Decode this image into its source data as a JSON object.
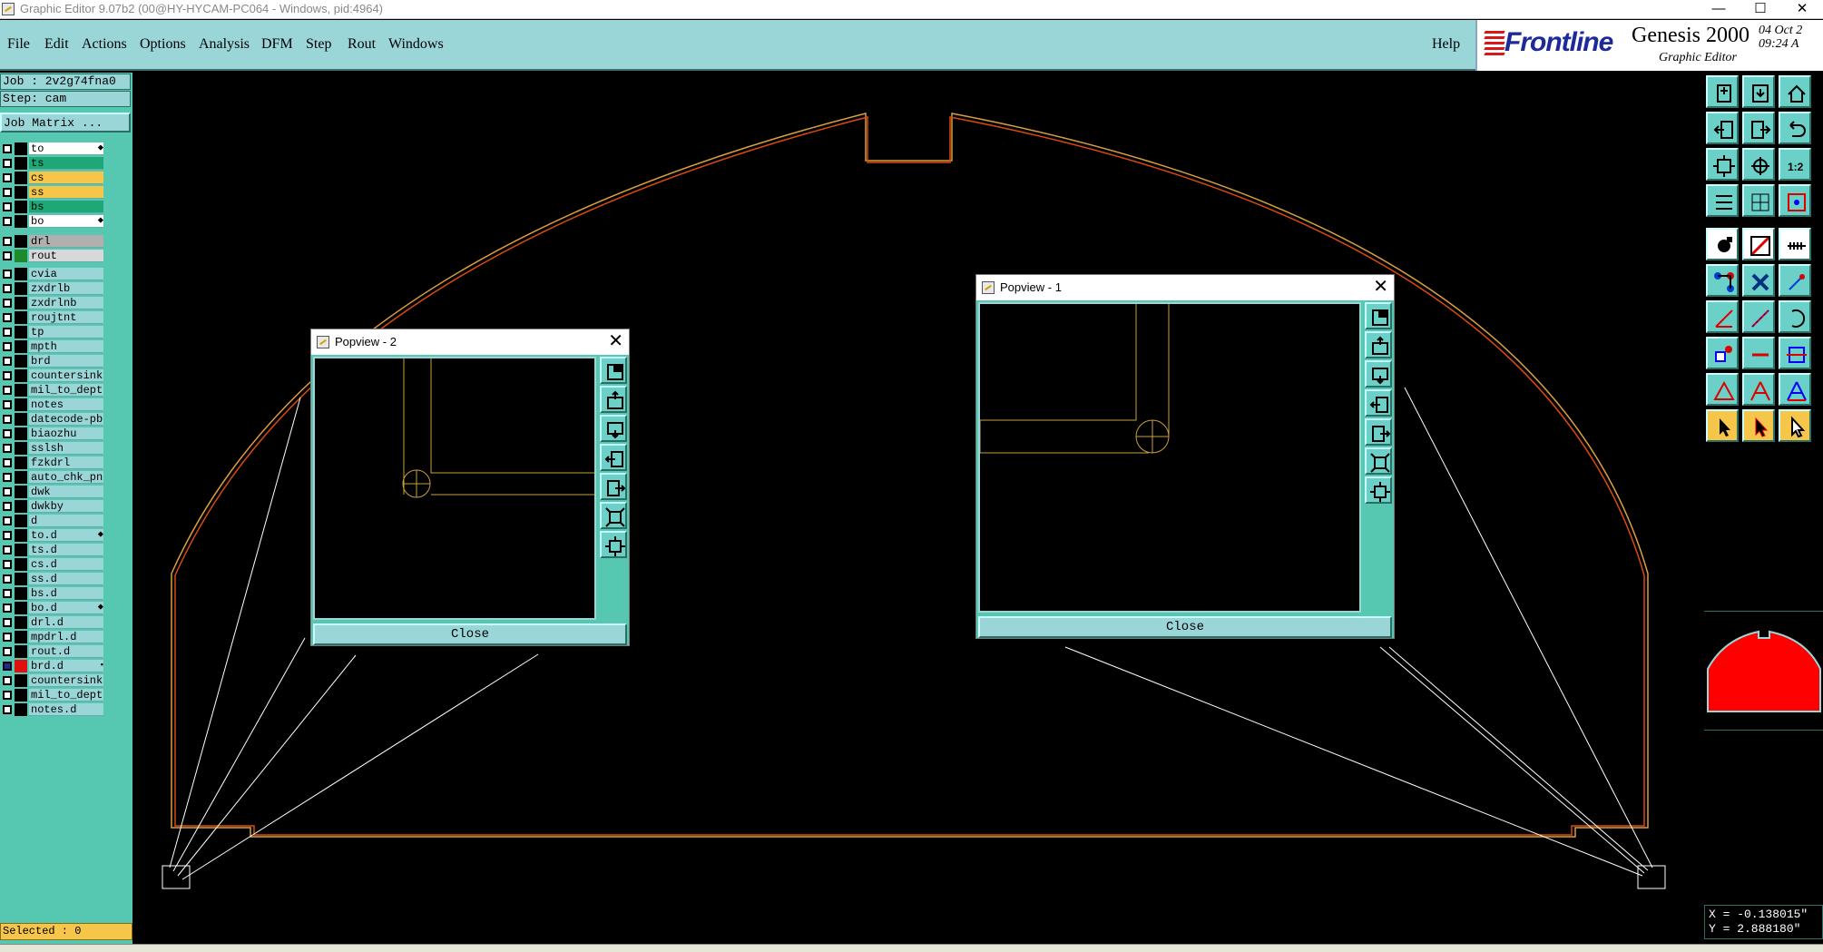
{
  "window": {
    "title": "Graphic Editor 9.07b2 (00@HY-HYCAM-PC064 - Windows, pid:4964)",
    "controls": [
      "—",
      "☐",
      "✕"
    ]
  },
  "menu": [
    {
      "label": "File"
    },
    {
      "label": "Edit"
    },
    {
      "label": "Actions"
    },
    {
      "label": "Options"
    },
    {
      "label": "Analysis"
    },
    {
      "label": "DFM"
    },
    {
      "label": "Step"
    },
    {
      "label": "Rout"
    },
    {
      "label": "Windows"
    }
  ],
  "help_label": "Help",
  "logo": {
    "brand": "Frontline",
    "product": "Genesis 2000",
    "subtitle": "Graphic Editor",
    "date_line1": "04 Oct 2",
    "date_line2": "09:24 A"
  },
  "job": {
    "job_label": "Job : 2v2g74fna0",
    "step_label": "Step: cam",
    "matrix_label": "Job Matrix ..."
  },
  "layer_groups": [
    [
      {
        "name": "to",
        "swatch": "#000000",
        "bg": "#ffffff",
        "mark": "⬥"
      },
      {
        "name": "ts",
        "swatch": "#000000",
        "bg": "#1ea878",
        "mark": ""
      },
      {
        "name": "cs",
        "swatch": "#000000",
        "bg": "#f6c64a",
        "mark": ""
      },
      {
        "name": "ss",
        "swatch": "#000000",
        "bg": "#f6c64a",
        "mark": ""
      },
      {
        "name": "bs",
        "swatch": "#000000",
        "bg": "#1ea878",
        "mark": ""
      },
      {
        "name": "bo",
        "swatch": "#000000",
        "bg": "#ffffff",
        "mark": "⬥"
      }
    ],
    [
      {
        "name": "drl",
        "swatch": "#000000",
        "bg": "#b0b0b0",
        "mark": ""
      },
      {
        "name": "rout",
        "swatch": "#1e8a2a",
        "bg": "#d8d8d8",
        "mark": ""
      }
    ],
    [
      {
        "name": "cvia",
        "swatch": "#000000",
        "bg": "",
        "mark": ""
      },
      {
        "name": "zxdrlb",
        "swatch": "#000000",
        "bg": "",
        "mark": ""
      },
      {
        "name": "zxdrlnb",
        "swatch": "#000000",
        "bg": "",
        "mark": ""
      },
      {
        "name": "roujtnt",
        "swatch": "#000000",
        "bg": "",
        "mark": ""
      },
      {
        "name": "tp",
        "swatch": "#000000",
        "bg": "",
        "mark": ""
      },
      {
        "name": "mpth",
        "swatch": "#000000",
        "bg": "",
        "mark": ""
      },
      {
        "name": "brd",
        "swatch": "#000000",
        "bg": "",
        "mark": ""
      },
      {
        "name": "countersink",
        "swatch": "#000000",
        "bg": "",
        "mark": ""
      },
      {
        "name": "mil_to_depth",
        "swatch": "#000000",
        "bg": "",
        "mark": ""
      },
      {
        "name": "notes",
        "swatch": "#000000",
        "bg": "",
        "mark": ""
      },
      {
        "name": "datecode-pb",
        "swatch": "#000000",
        "bg": "",
        "mark": ""
      },
      {
        "name": "biaozhu",
        "swatch": "#000000",
        "bg": "",
        "mark": ""
      },
      {
        "name": "sslsh",
        "swatch": "#000000",
        "bg": "",
        "mark": ""
      },
      {
        "name": "fzkdrl",
        "swatch": "#000000",
        "bg": "",
        "mark": ""
      },
      {
        "name": "auto_chk_pn",
        "swatch": "#000000",
        "bg": "",
        "mark": ""
      },
      {
        "name": "dwk",
        "swatch": "#000000",
        "bg": "",
        "mark": ""
      },
      {
        "name": "dwkby",
        "swatch": "#000000",
        "bg": "",
        "mark": ""
      },
      {
        "name": "d",
        "swatch": "#000000",
        "bg": "",
        "mark": ""
      },
      {
        "name": "to.d",
        "swatch": "#000000",
        "bg": "",
        "mark": "⬥"
      },
      {
        "name": "ts.d",
        "swatch": "#000000",
        "bg": "",
        "mark": ""
      },
      {
        "name": "cs.d",
        "swatch": "#000000",
        "bg": "",
        "mark": ""
      },
      {
        "name": "ss.d",
        "swatch": "#000000",
        "bg": "",
        "mark": ""
      },
      {
        "name": "bs.d",
        "swatch": "#000000",
        "bg": "",
        "mark": ""
      },
      {
        "name": "bo.d",
        "swatch": "#000000",
        "bg": "",
        "mark": "⬥"
      },
      {
        "name": "drl.d",
        "swatch": "#000000",
        "bg": "",
        "mark": ""
      },
      {
        "name": "mpdrl.d",
        "swatch": "#000000",
        "bg": "",
        "mark": ""
      },
      {
        "name": "rout.d",
        "swatch": "#000000",
        "bg": "",
        "mark": ""
      },
      {
        "name": "brd.d",
        "swatch": "#e01010",
        "bg": "",
        "mark": "▪",
        "checked": true
      },
      {
        "name": "countersink",
        "swatch": "#000000",
        "bg": "",
        "mark": ""
      },
      {
        "name": "mil_to_depth",
        "swatch": "#000000",
        "bg": "",
        "mark": ""
      },
      {
        "name": "notes.d",
        "swatch": "#000000",
        "bg": "",
        "mark": ""
      }
    ]
  ],
  "selected_label": "Selected : 0",
  "popviews": [
    {
      "title": "Popview - 2",
      "close_label": "Close"
    },
    {
      "title": "Popview - 1",
      "close_label": "Close"
    }
  ],
  "coords": {
    "x_label": "X = -0.138015\"",
    "y_label": "Y = 2.888180\""
  },
  "colors": {
    "outline": "#d8a040",
    "outline_inner": "#d84a10",
    "thumb_fill": "#ff0000"
  },
  "tools": [
    "open-step-icon",
    "save-step-icon",
    "home-icon",
    "zoom-left-icon",
    "zoom-right-icon",
    "undo-icon",
    "fit-icon",
    "center-icon",
    "scale-icon",
    "layers-icon",
    "grid-icon",
    "snap-icon",
    "pad-icon",
    "mirror-icon",
    "ruler-icon",
    "nodes-icon",
    "cross-icon",
    "arrow-icon",
    "line-icon",
    "slash-icon",
    "arc-icon",
    "square-icon",
    "minus-icon",
    "box-icon",
    "triangle-icon",
    "text-a-icon",
    "text-b-icon",
    "select-arrow-icon",
    "select-cursor-icon",
    "pointer-icon"
  ]
}
